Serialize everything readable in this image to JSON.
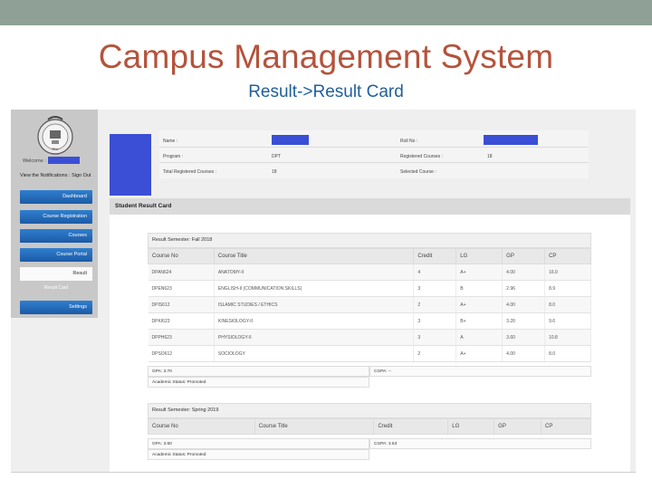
{
  "slide": {
    "title": "Campus Management System",
    "subtitle": "Result->Result Card"
  },
  "sidebar": {
    "welcome": "Welcome :",
    "notifications": "View the Notifications : Sign Out",
    "items": [
      {
        "label": "Dashboard"
      },
      {
        "label": "Course Registration"
      },
      {
        "label": "Courses"
      },
      {
        "label": "Course Portal"
      },
      {
        "label": "Result"
      },
      {
        "label": "Result Card"
      },
      {
        "label": "Settings"
      }
    ]
  },
  "student_info": {
    "name_label": "Name :",
    "roll_label": "Roll No :",
    "program_label": "Program :",
    "program_value": "DPT",
    "registered_label": "Registered Courses :",
    "registered_value": "18",
    "total_label": "Total Registered Courses :",
    "total_value": "18",
    "selected_label": "Selected Course :"
  },
  "card": {
    "title": "Student Result Card"
  },
  "columns": [
    "Course No",
    "Course Title",
    "Credit",
    "LG",
    "GP",
    "CP"
  ],
  "semesters": [
    {
      "title": "Result Semester: Fall 2018",
      "rows": [
        [
          "DPAN624",
          "ANATOMY-II",
          "4",
          "A+",
          "4.00",
          "16.0"
        ],
        [
          "DPEN623",
          "ENGLISH-II (COMMUNICATION SKILLS)",
          "3",
          "B",
          "2.96",
          "8.9"
        ],
        [
          "DPIS612",
          "ISLAMIC STUDIES / ETHICS",
          "2",
          "A+",
          "4.00",
          "8.0"
        ],
        [
          "DPKI623",
          "KINESIOLOGY-II",
          "3",
          "B+",
          "3.20",
          "9.6"
        ],
        [
          "DPPH623",
          "PHYSIOLOGY-II",
          "3",
          "A",
          "3.60",
          "10.8"
        ],
        [
          "DPSO612",
          "SOCIOLOGY",
          "2",
          "A+",
          "4.00",
          "8.0"
        ]
      ],
      "gpa": "GPA: 3.70",
      "cgpa": "CGPA: --",
      "status": "Academic Status: Promoted"
    },
    {
      "title": "Result Semester: Spring 2019",
      "rows": [],
      "gpa": "GPA: 3.60",
      "cgpa": "CGPA: 3.63",
      "status": "Academic Status: Promoted"
    }
  ],
  "colors": {
    "title": "#b5533c",
    "subtitle": "#1f5f9a",
    "nav": "#1c5aa6",
    "redaction": "#3a4fd6"
  }
}
